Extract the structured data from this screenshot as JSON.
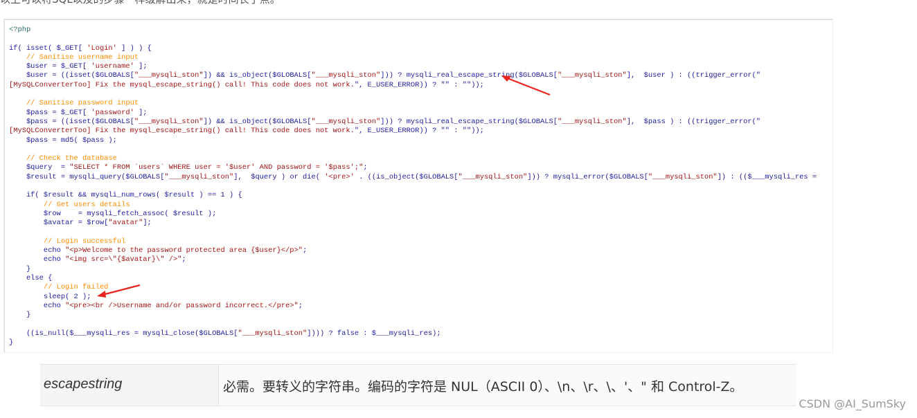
{
  "top_text": "以上可以将SQL以及的步骤一样级解出来，就是时间长了点。",
  "code_lines": [
    "<?php",
    "",
    "if( isset( $_GET[ 'Login' ] ) ) {",
    "    // Sanitise username input",
    "    $user = $_GET[ 'username' ];",
    "    $user = ((isset($GLOBALS[\"___mysqli_ston\"]) && is_object($GLOBALS[\"___mysqli_ston\"])) ? mysqli_real_escape_string($GLOBALS[\"___mysqli_ston\"],  $user ) : ((trigger_error(\"",
    "[MySQLConverterToo] Fix the mysql_escape_string() call! This code does not work.\", E_USER_ERROR)) ? \"\" : \"\"));",
    "",
    "    // Sanitise password input",
    "    $pass = $_GET[ 'password' ];",
    "    $pass = ((isset($GLOBALS[\"___mysqli_ston\"]) && is_object($GLOBALS[\"___mysqli_ston\"])) ? mysqli_real_escape_string($GLOBALS[\"___mysqli_ston\"],  $pass ) : ((trigger_error(\"",
    "[MySQLConverterToo] Fix the mysql_escape_string() call! This code does not work.\", E_USER_ERROR)) ? \"\" : \"\"));",
    "    $pass = md5( $pass );",
    "",
    "    // Check the database",
    "    $query  = \"SELECT * FROM `users` WHERE user = '$user' AND password = '$pass';\";",
    "    $result = mysqli_query($GLOBALS[\"___mysqli_ston\"],  $query ) or die( '<pre>' . ((is_object($GLOBALS[\"___mysqli_ston\"])) ? mysqli_error($GLOBALS[\"___mysqli_ston\"]) : (($___mysqli_res =",
    "",
    "    if( $result && mysqli_num_rows( $result ) == 1 ) {",
    "        // Get users details",
    "        $row    = mysqli_fetch_assoc( $result );",
    "        $avatar = $row[\"avatar\"];",
    "",
    "        // Login successful",
    "        echo \"<p>Welcome to the password protected area {$user}</p>\";",
    "        echo \"<img src=\\\"{$avatar}\\\" />\";",
    "    }",
    "    else {",
    "        // Login failed",
    "        sleep( 2 );",
    "        echo \"<pre><br />Username and/or password incorrect.</pre>\";",
    "    }",
    "",
    "    ((is_null($___mysqli_res = mysqli_close($GLOBALS[\"___mysqli_ston\"]))) ? false : $___mysqli_res);",
    "}"
  ],
  "table": {
    "param": "escapestring",
    "description": "必需。要转义的字符串。编码的字符是 NUL（ASCII 0）、\\n、\\r、\\、'、\" 和 Control-Z。"
  },
  "watermark": "CSDN @AI_SumSky",
  "colors": {
    "code_text": "#2020a0",
    "comment": "#ff8c00",
    "string": "#a31515",
    "arrow": "#e8251f"
  }
}
